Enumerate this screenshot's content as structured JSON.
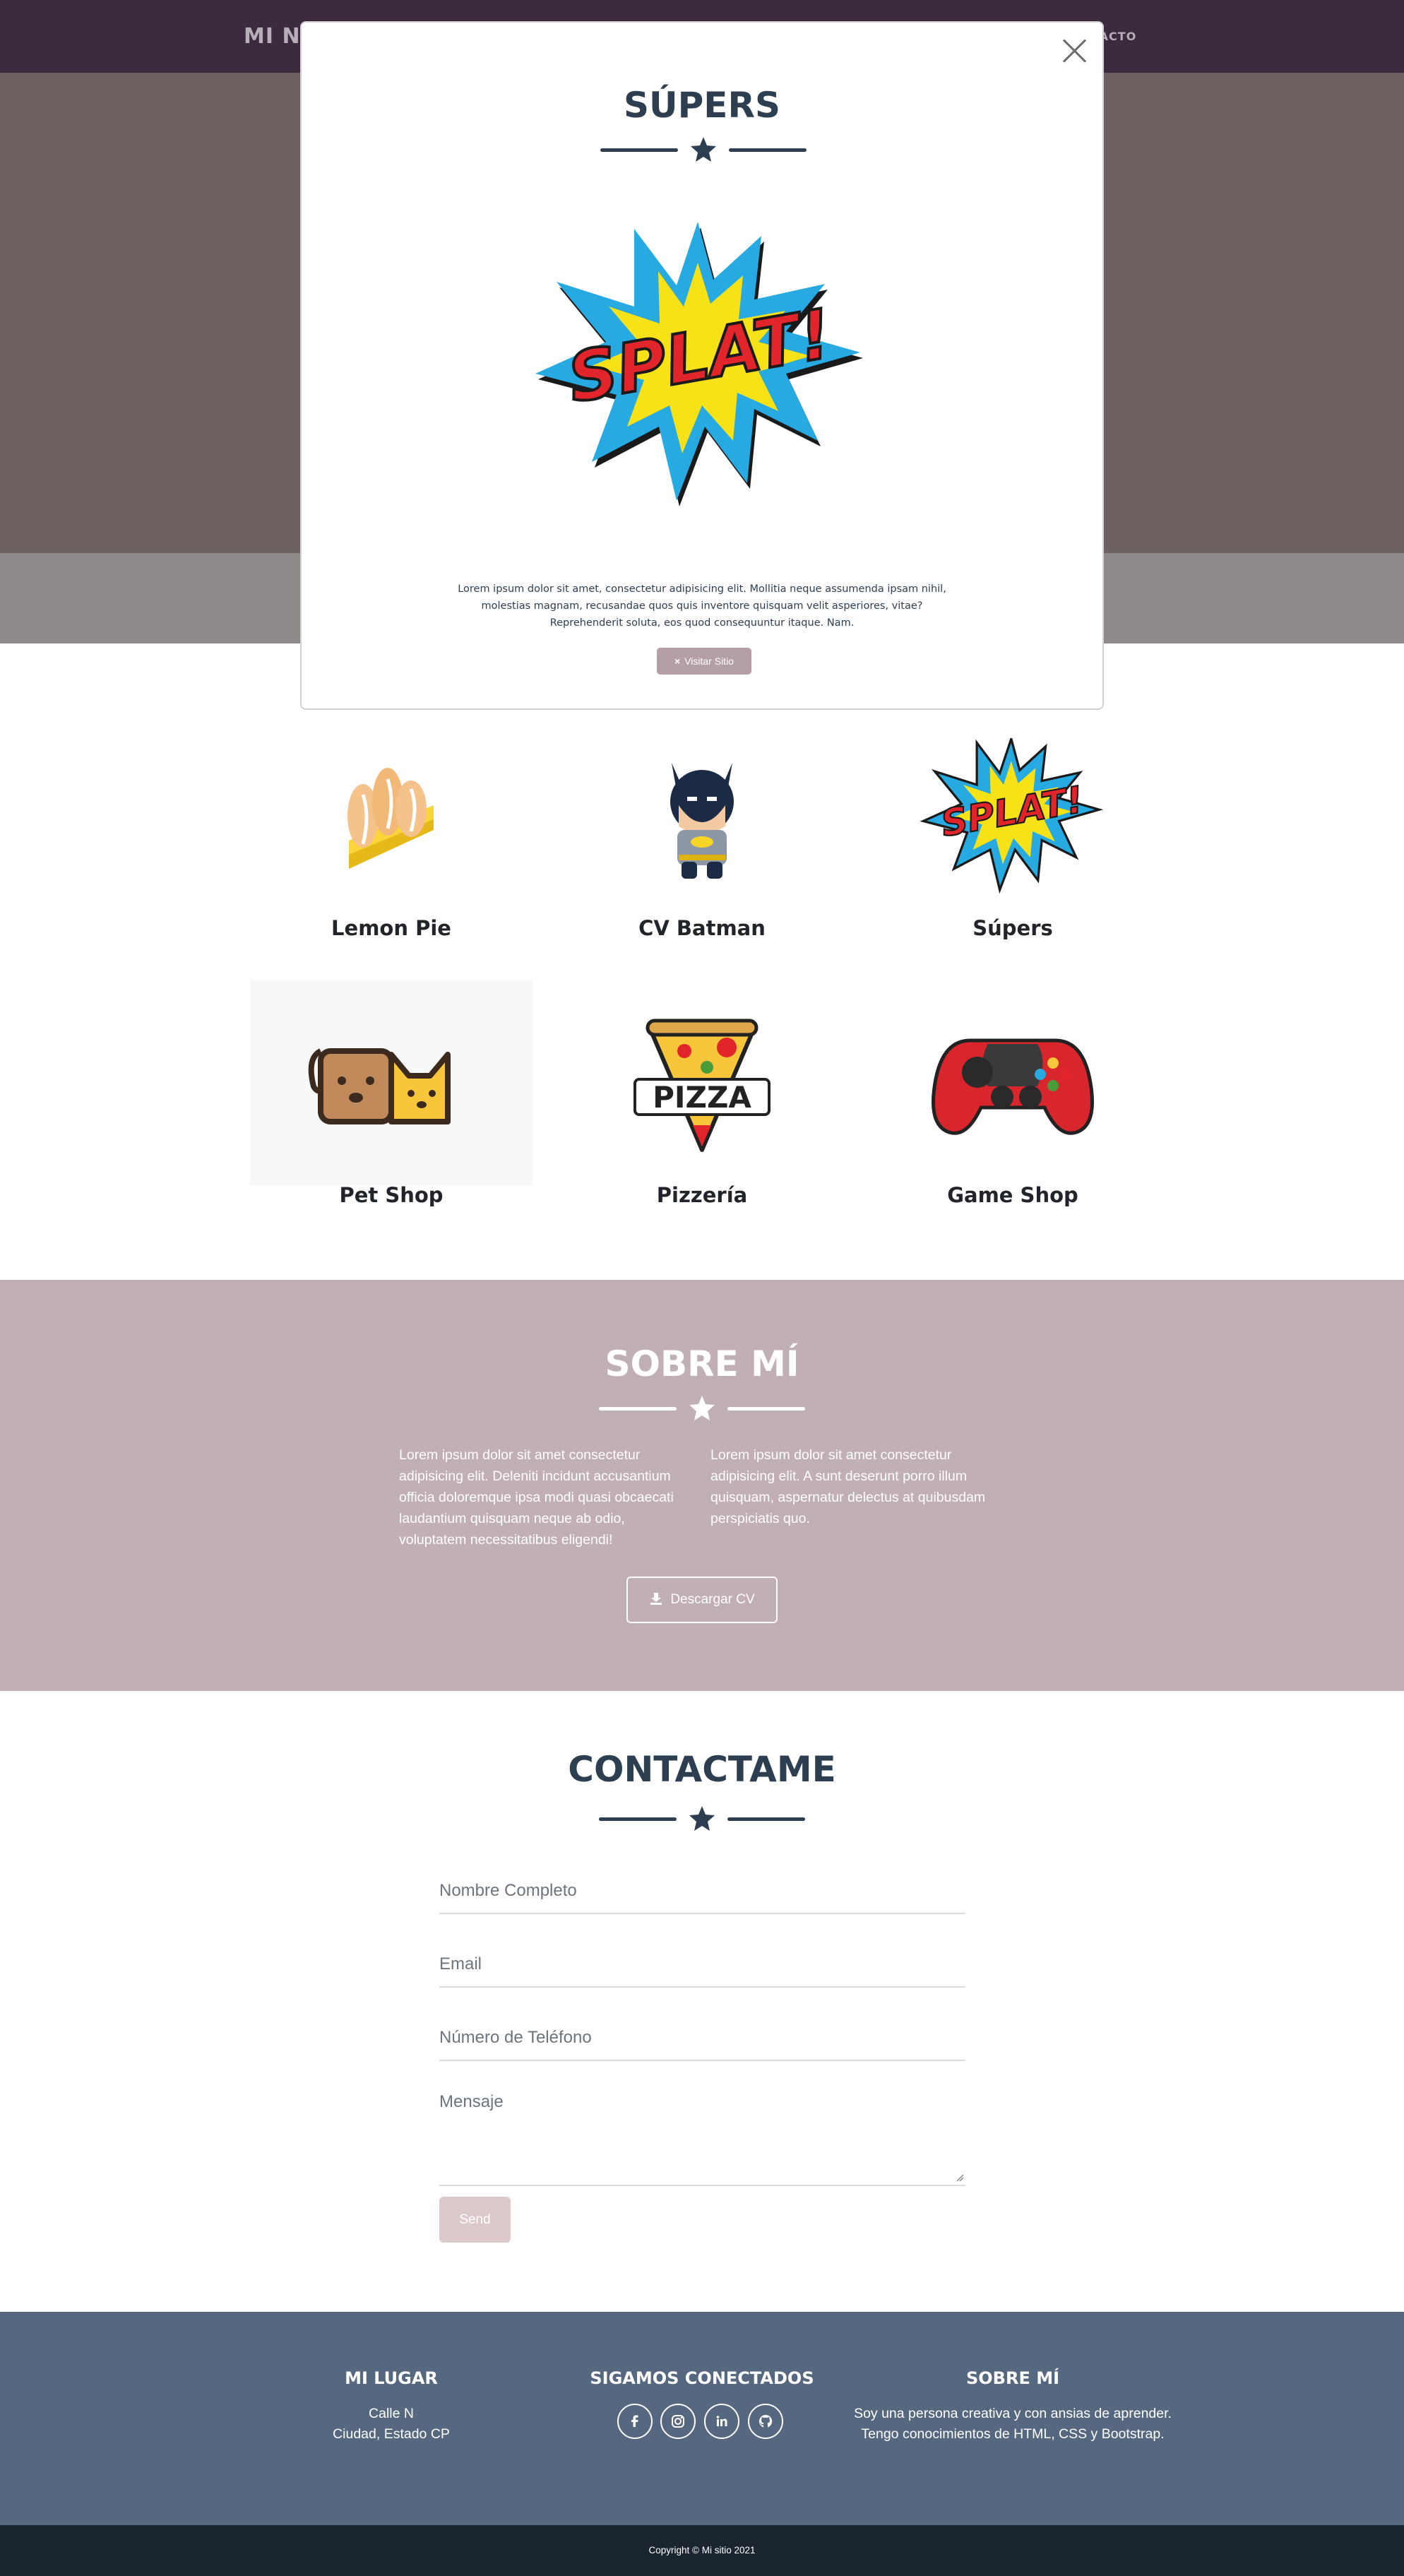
{
  "navbar": {
    "brand": "MI NO",
    "link_contact": "TACTO"
  },
  "modal": {
    "title": "SÚPERS",
    "text": "Lorem ipsum dolor sit amet, consectetur adipisicing elit. Mollitia neque assumenda ipsam nihil, molestias magnam, recusandae quos quis inventore quisquam velit asperiores, vitae? Reprehenderit soluta, eos quod consequuntur itaque. Nam.",
    "button_icon": "×",
    "button_label": "Visitar Sitio",
    "image_text": "SPLAT!"
  },
  "portfolio": {
    "items": [
      {
        "caption": "Lemon Pie",
        "icon": "lemon-pie"
      },
      {
        "caption": "CV Batman",
        "icon": "batman"
      },
      {
        "caption": "Súpers",
        "icon": "splat",
        "image_text": "SPLAT!"
      },
      {
        "caption": "Pet Shop",
        "icon": "dog-cat"
      },
      {
        "caption": "Pizzería",
        "icon": "pizza",
        "image_text": "PIZZA"
      },
      {
        "caption": "Game Shop",
        "icon": "gamepad"
      }
    ]
  },
  "about": {
    "title": "SOBRE MÍ",
    "col_left": "Lorem ipsum dolor sit amet consectetur adipisicing elit. Deleniti incidunt accusantium officia doloremque ipsa modi quasi obcaecati laudantium quisquam neque ab odio, voluptatem necessitatibus eligendi!",
    "col_right": "Lorem ipsum dolor sit amet consectetur adipisicing elit. A sunt deserunt porro illum quisquam, aspernatur delectus at quibusdam perspiciatis quo.",
    "button_label": "Descargar CV"
  },
  "contact": {
    "title": "CONTACTAME",
    "name_placeholder": "Nombre Completo",
    "email_placeholder": "Email",
    "phone_placeholder": "Número de Teléfono",
    "message_placeholder": "Mensaje",
    "send_label": "Send"
  },
  "footer": {
    "location_title": "MI LUGAR",
    "location_line1": "Calle N",
    "location_line2": "Ciudad, Estado CP",
    "social_title": "SIGAMOS CONECTADOS",
    "social_icons": [
      "facebook-icon",
      "instagram-icon",
      "linkedin-icon",
      "github-icon"
    ],
    "about_title": "SOBRE MÍ",
    "about_text": "Soy una persona creativa y con ansias de aprender. Tengo conocimientos de HTML, CSS y Bootstrap."
  },
  "copyright": "Copyright © Mi sitio 2021",
  "colors": {
    "navbar": "#3c2a3f",
    "primary_text": "#2c3e50",
    "about_bg": "#c1b0b3",
    "footer_bg": "#566780",
    "copyright_bg": "#1a252f"
  }
}
